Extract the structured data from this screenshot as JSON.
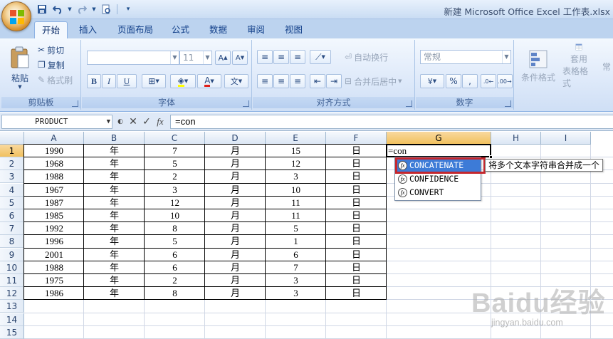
{
  "window": {
    "title": "新建 Microsoft Office Excel 工作表.xlsx"
  },
  "qat": {
    "icons": [
      "save-icon",
      "undo-icon",
      "redo-icon",
      "print-preview-icon",
      "customize-icon"
    ]
  },
  "tabs": [
    "开始",
    "插入",
    "页面布局",
    "公式",
    "数据",
    "审阅",
    "视图"
  ],
  "ribbon": {
    "clipboard": {
      "label": "剪贴板",
      "paste": "粘贴",
      "cut": "剪切",
      "copy": "复制",
      "format_painter": "格式刷"
    },
    "font": {
      "label": "字体",
      "size": "11",
      "bold": "B",
      "italic": "I",
      "underline": "U"
    },
    "alignment": {
      "label": "对齐方式",
      "wrap": "自动换行",
      "merge": "合并后居中"
    },
    "number": {
      "label": "数字",
      "format": "常规"
    },
    "styles": {
      "conditional": "条件格式",
      "table": "套用",
      "table2": "表格格式"
    }
  },
  "formula_bar": {
    "name_box": "PRODUCT",
    "formula": "=con"
  },
  "columns": [
    "A",
    "B",
    "C",
    "D",
    "E",
    "F",
    "G",
    "H",
    "I"
  ],
  "rows": [
    "1",
    "2",
    "3",
    "4",
    "5",
    "6",
    "7",
    "8",
    "9",
    "10",
    "11",
    "12",
    "13",
    "14",
    "15"
  ],
  "cells": [
    [
      "1990",
      "年",
      "7",
      "月",
      "15",
      "日"
    ],
    [
      "1968",
      "年",
      "5",
      "月",
      "12",
      "日"
    ],
    [
      "1988",
      "年",
      "2",
      "月",
      "3",
      "日"
    ],
    [
      "1967",
      "年",
      "3",
      "月",
      "10",
      "日"
    ],
    [
      "1987",
      "年",
      "12",
      "月",
      "11",
      "日"
    ],
    [
      "1985",
      "年",
      "10",
      "月",
      "11",
      "日"
    ],
    [
      "1992",
      "年",
      "8",
      "月",
      "5",
      "日"
    ],
    [
      "1996",
      "年",
      "5",
      "月",
      "1",
      "日"
    ],
    [
      "2001",
      "年",
      "6",
      "月",
      "6",
      "日"
    ],
    [
      "1988",
      "年",
      "6",
      "月",
      "7",
      "日"
    ],
    [
      "1975",
      "年",
      "2",
      "月",
      "3",
      "日"
    ],
    [
      "1986",
      "年",
      "8",
      "月",
      "3",
      "日"
    ]
  ],
  "active_cell": {
    "ref": "G1",
    "text": "=con"
  },
  "autocomplete": {
    "items": [
      "CONCATENATE",
      "CONFIDENCE",
      "CONVERT"
    ],
    "selected": 0,
    "tooltip": "将多个文本字符串合并成一个"
  },
  "watermark": {
    "logo": "Baidu经验",
    "url": "jingyan.baidu.com"
  },
  "colors": {
    "accent": "#3d7bd7",
    "highlight": "#c5272d",
    "selected_header": "#f1c15f"
  }
}
